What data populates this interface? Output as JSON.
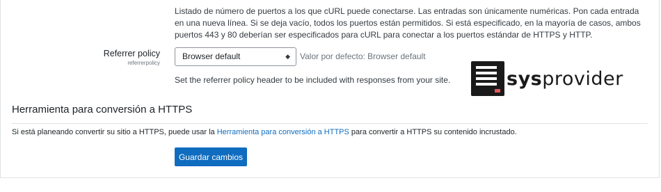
{
  "ports_description": "Listado de número de puertos a los que cURL puede conectarse. Las entradas son únicamente numéricas. Pon cada entrada en una nueva línea. Si se deja vacío, todos los puertos están permitidos. Si está especificado, en la mayoría de casos, ambos puertos 443 y 80 deberían ser especificados para cURL para conectar a los puertos estándar de HTTPS y HTTP.",
  "referrer": {
    "label": "Referrer policy",
    "sublabel": "referrerpolicy",
    "selected_value": "Browser default",
    "default_note": "Valor por defecto: Browser default",
    "description": "Set the referrer policy header to be included with responses from your site."
  },
  "logo": {
    "text_bold": "sys",
    "text_light": "provider"
  },
  "https_section": {
    "heading": "Herramienta para conversión a HTTPS",
    "text_before": "Si está planeando convertir su sitio a HTTPS, puede usar la ",
    "link_text": "Herramienta para conversión a HTTPS",
    "text_after": " para convertir a HTTPS su contenido incrustado."
  },
  "save_label": "Guardar cambios",
  "icons": {
    "select_arrow": "up-down-chevron-icon",
    "logo_mark": "server-icon"
  },
  "colors": {
    "primary": "#0f6cbf",
    "text": "#1d2125",
    "muted": "#6a737b",
    "logo_red": "#e4575a"
  }
}
